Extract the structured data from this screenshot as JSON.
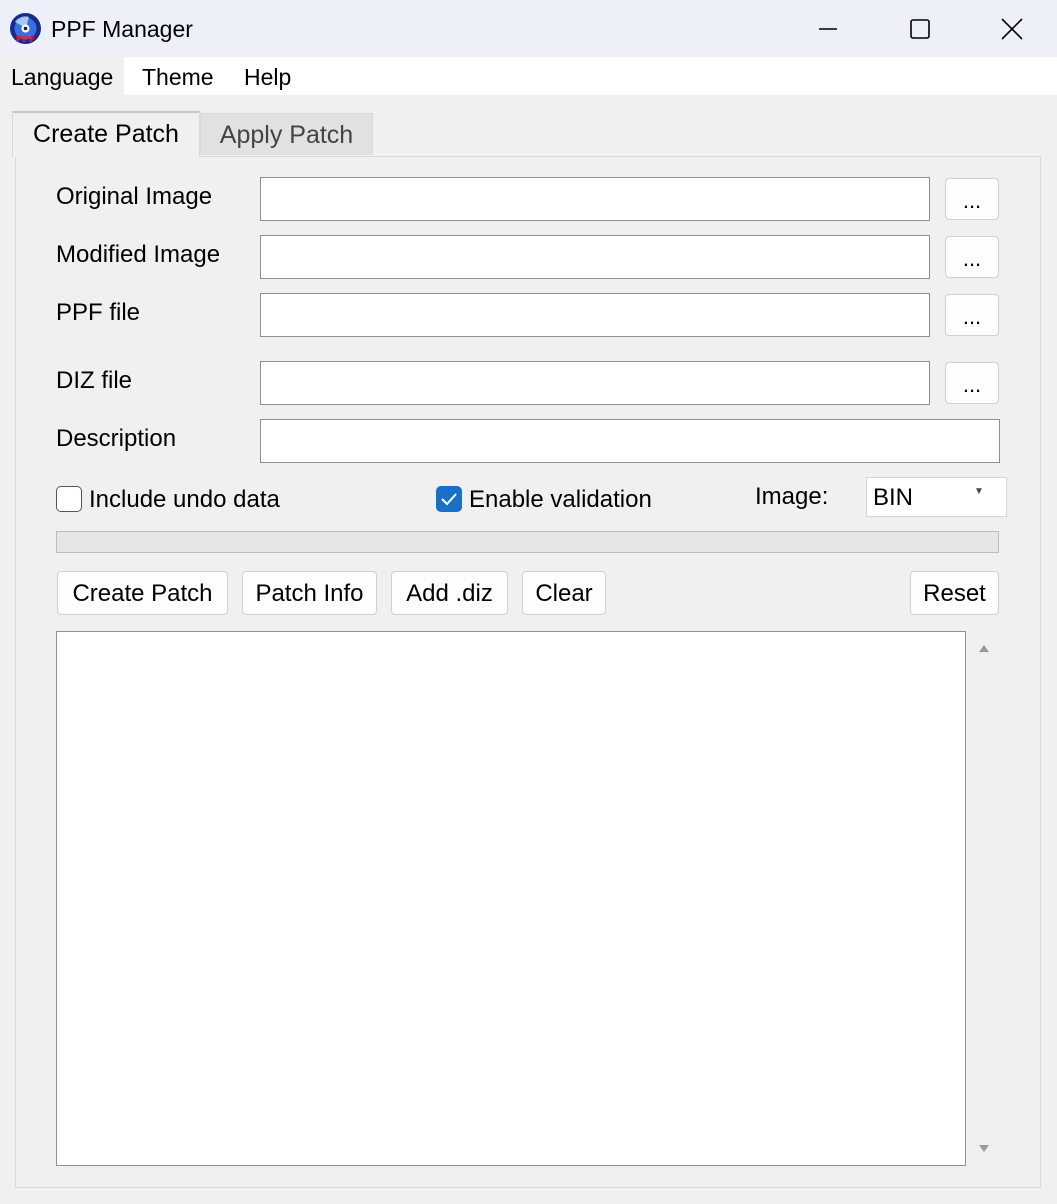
{
  "window": {
    "title": "PPF Manager",
    "icon_name": "ppf-disc-icon"
  },
  "menu": {
    "items": [
      "Language",
      "Theme",
      "Help"
    ]
  },
  "tabs": [
    {
      "label": "Create Patch",
      "selected": true
    },
    {
      "label": "Apply Patch",
      "selected": false
    }
  ],
  "form": {
    "original_image": {
      "label": "Original Image",
      "value": "",
      "browse_label": "..."
    },
    "modified_image": {
      "label": "Modified Image",
      "value": "",
      "browse_label": "..."
    },
    "ppf_file": {
      "label": "PPF file",
      "value": "",
      "browse_label": "..."
    },
    "diz_file": {
      "label": "DIZ file",
      "value": "",
      "browse_label": "..."
    },
    "description": {
      "label": "Description",
      "value": ""
    }
  },
  "options": {
    "include_undo": {
      "label": "Include undo data",
      "checked": false
    },
    "enable_validation": {
      "label": "Enable validation",
      "checked": true
    },
    "image_type": {
      "label": "Image:",
      "selected": "BIN"
    }
  },
  "progress": {
    "value": 0
  },
  "actions": {
    "create_patch": "Create Patch",
    "patch_info": "Patch Info",
    "add_diz": "Add .diz",
    "clear": "Clear",
    "reset": "Reset"
  },
  "log": {
    "text": ""
  },
  "colors": {
    "accent": "#1a6fc9",
    "titlebar": "#eef0f9",
    "window_bg": "#f0f0f0"
  }
}
